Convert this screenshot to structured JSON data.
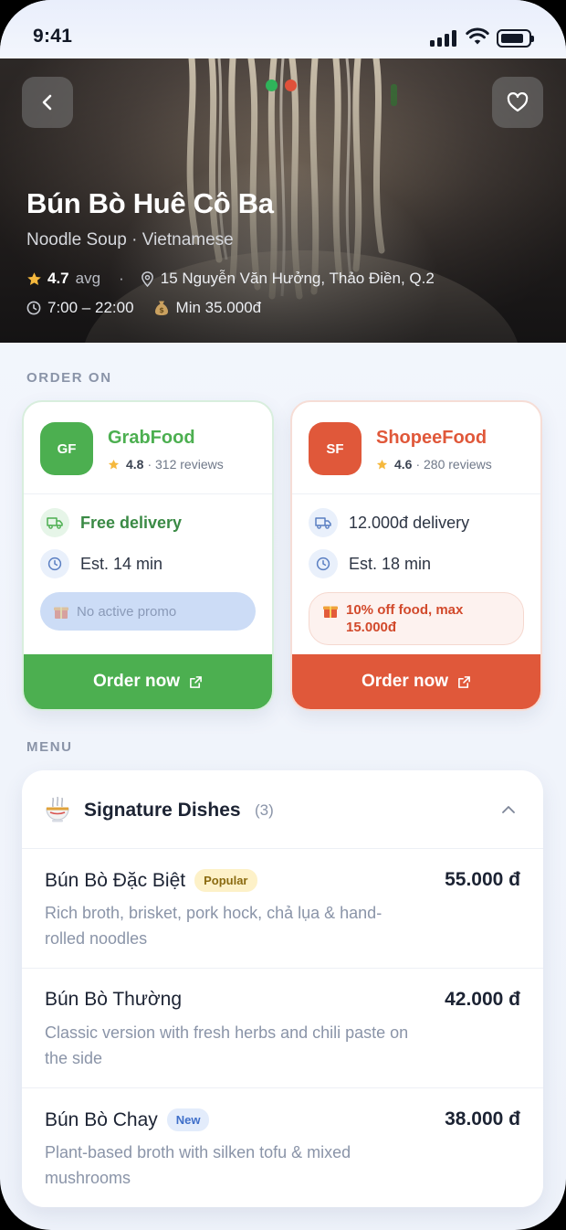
{
  "status": {
    "time": "9:41"
  },
  "hero": {
    "title": "Bún Bò Huê Cô Ba",
    "subtitle": "Noodle Soup · Vietnamese",
    "rating": "4.7",
    "rating_suffix": "avg",
    "address": "15 Nguyễn Văn Hưởng, Thảo Điền, Q.2",
    "hours": "7:00 – 22:00",
    "min_order": "Min 35.000đ",
    "carousel_dot_colors": [
      "#2fb35a",
      "#e0513a"
    ]
  },
  "order_section": {
    "label": "ORDER ON",
    "platforms": [
      {
        "logo": "GF",
        "name": "GrabFood",
        "rating": "4.8",
        "reviews": "· 312 reviews",
        "delivery": "Free delivery",
        "eta": "Est. 14 min",
        "promo": "No active promo",
        "cta": "Order now",
        "color": "#4caf50"
      },
      {
        "logo": "SF",
        "name": "ShopeeFood",
        "rating": "4.6",
        "reviews": "· 280 reviews",
        "delivery": "12.000đ delivery",
        "eta": "Est. 18 min",
        "promo": "10% off food, max 15.000đ",
        "cta": "Order now",
        "color": "#e0583a"
      }
    ]
  },
  "menu": {
    "label": "MENU",
    "category": "Signature Dishes",
    "count": "(3)",
    "items": [
      {
        "name": "Bún Bò Đặc Biệt",
        "badge": "Popular",
        "desc": "Rich broth, brisket, pork hock, chả lụa & hand-rolled noodles",
        "price": "55.000 đ"
      },
      {
        "name": "Bún Bò Thường",
        "badge": "",
        "desc": "Classic version with fresh herbs and chili paste on the side",
        "price": "42.000 đ"
      },
      {
        "name": "Bún Bò Chay",
        "badge": "New",
        "desc": "Plant-based broth with silken tofu & mixed mushrooms",
        "price": "38.000 đ"
      }
    ]
  }
}
